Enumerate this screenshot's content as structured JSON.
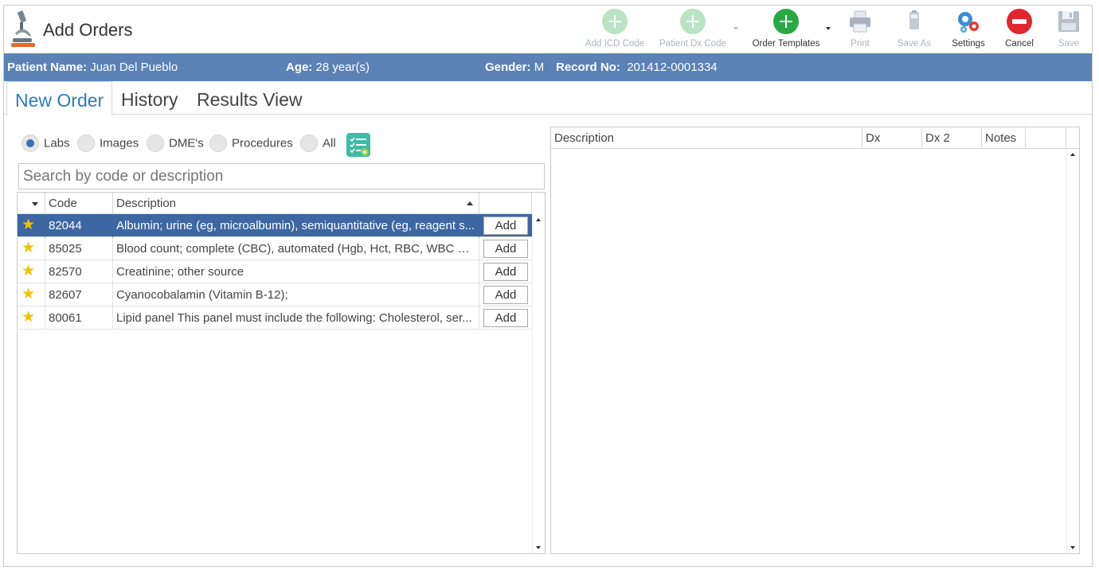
{
  "window": {
    "title": "Add Orders",
    "app_icon": "microscope-icon"
  },
  "toolbar": {
    "items": [
      {
        "label": "Add ICD Code",
        "icon": "add-circle-icon",
        "enabled": false
      },
      {
        "label": "Patient Dx Code",
        "icon": "add-circle-icon",
        "enabled": false,
        "has_dropdown": true
      },
      {
        "label": "Order Templates",
        "icon": "add-circle-icon",
        "enabled": true,
        "has_dropdown": true
      },
      {
        "label": "Print",
        "icon": "printer-icon",
        "enabled": false
      },
      {
        "label": "Save As",
        "icon": "save-as-icon",
        "enabled": false
      },
      {
        "label": "Settings",
        "icon": "gears-icon",
        "enabled": true
      },
      {
        "label": "Cancel",
        "icon": "cancel-icon",
        "enabled": true
      },
      {
        "label": "Save",
        "icon": "floppy-disk-icon",
        "enabled": false
      }
    ]
  },
  "patient": {
    "name_label": "Patient Name:",
    "name": "Juan Del Pueblo",
    "age_label": "Age:",
    "age": "28 year(s)",
    "gender_label": "Gender:",
    "gender": "M",
    "record_label": "Record No:",
    "record": "201412-0001334"
  },
  "tabs": [
    {
      "label": "New Order",
      "active": true
    },
    {
      "label": "History",
      "active": false
    },
    {
      "label": "Results View",
      "active": false
    }
  ],
  "filters": {
    "options": [
      "Labs",
      "Images",
      "DME's",
      "Procedures",
      "All"
    ],
    "selected": "Labs",
    "add_button_icon": "checklist-add-icon"
  },
  "search": {
    "placeholder": "Search by code or description",
    "value": ""
  },
  "catalog": {
    "columns": [
      "",
      "Code",
      "Description",
      ""
    ],
    "add_label": "Add",
    "rows": [
      {
        "favorite": true,
        "code": "82044",
        "description": "Albumin; urine (eg, microalbumin), semiquantitative (eg, reagent s...",
        "selected": true
      },
      {
        "favorite": true,
        "code": "85025",
        "description": "Blood count; complete (CBC), automated (Hgb, Hct, RBC, WBC an...",
        "selected": false
      },
      {
        "favorite": true,
        "code": "82570",
        "description": "Creatinine; other source",
        "selected": false
      },
      {
        "favorite": true,
        "code": "82607",
        "description": "Cyanocobalamin (Vitamin B-12);",
        "selected": false
      },
      {
        "favorite": true,
        "code": "80061",
        "description": "Lipid panel This panel must include the following: Cholesterol, ser...",
        "selected": false
      }
    ]
  },
  "orders": {
    "columns": [
      "Description",
      "Dx",
      "Dx 2",
      "Notes",
      ""
    ],
    "rows": []
  },
  "colors": {
    "patient_bar": "#5b82b5",
    "selected_row": "#3c67a3",
    "active_tab": "#2e7ac0",
    "star": "#f2c200"
  }
}
